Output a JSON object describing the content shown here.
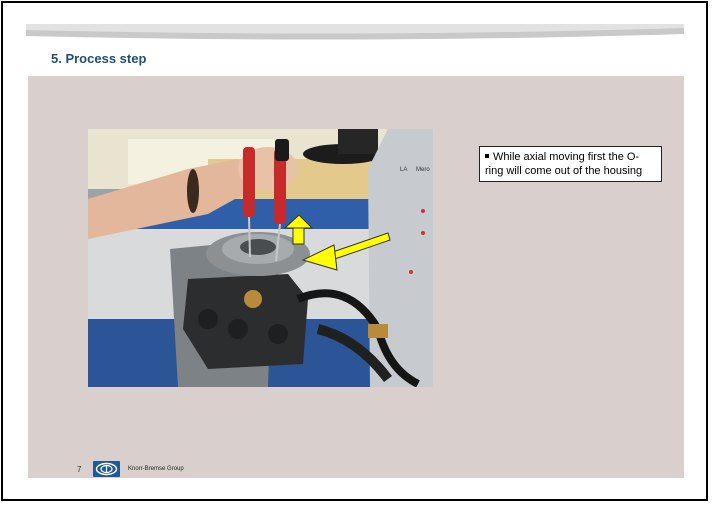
{
  "slide": {
    "title": "5. Process step",
    "bullet_text": "While axial moving first the O-ring will come out of the housing",
    "page_number": "7",
    "company": "Knorr-Bremse Group",
    "accent_color": "#1f4e79",
    "panel_color": "#d9d0cd"
  },
  "photo": {
    "panel_labels": [
      "LA",
      "Mero"
    ]
  },
  "icons": {
    "logo": "knorr-bremse-logo",
    "arrow_up": "up-arrow-icon",
    "arrow_left": "diagonal-arrow-icon"
  }
}
